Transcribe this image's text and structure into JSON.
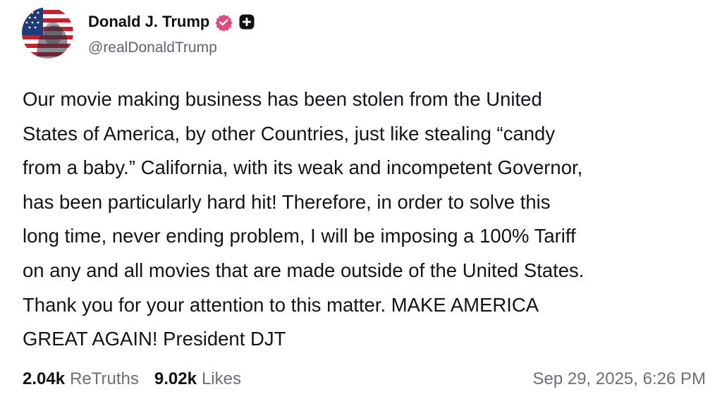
{
  "author": {
    "display_name": "Donald J. Trump",
    "handle": "@realDonaldTrump",
    "avatar_icon": "flag-portrait-avatar",
    "verified_icon": "verified-badge-icon",
    "verified_color": "#e9467d",
    "extra_badge_icon": "plus-badge-icon",
    "extra_badge_color": "#111111"
  },
  "post": {
    "lines": [
      "Our movie making business has been stolen from the United",
      "States of America, by other Countries, just like stealing “candy",
      "from a baby.” California, with its weak and incompetent Governor,",
      "has been particularly hard hit! Therefore, in order to solve this",
      "long time, never ending problem, I will be imposing a 100% Tariff",
      "on any and all movies that are made outside of the United States.",
      "Thank you for your attention to this matter. MAKE AMERICA",
      "GREAT AGAIN! President DJT"
    ]
  },
  "stats": {
    "retruths_count": "2.04k",
    "retruths_label": "ReTruths",
    "likes_count": "9.02k",
    "likes_label": "Likes"
  },
  "timestamp": "Sep 29, 2025, 6:26 PM"
}
